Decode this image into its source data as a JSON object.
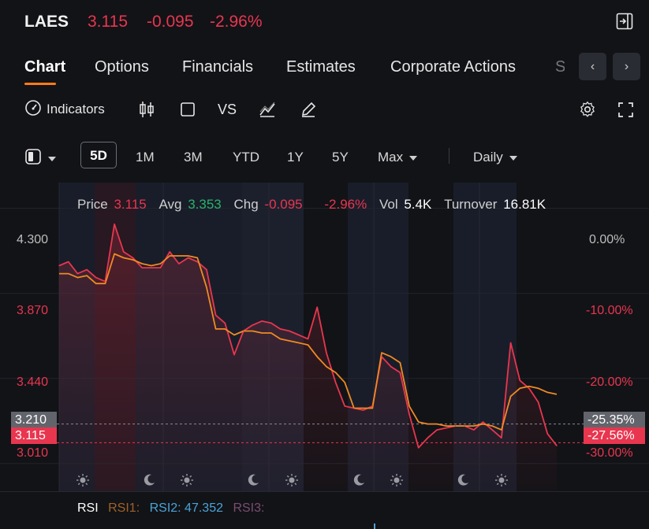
{
  "header": {
    "ticker": "LAES",
    "price": "3.115",
    "change": "-0.095",
    "change_pct": "-2.96%"
  },
  "tabs": [
    {
      "label": "Chart",
      "active": true
    },
    {
      "label": "Options"
    },
    {
      "label": "Financials"
    },
    {
      "label": "Estimates"
    },
    {
      "label": "Corporate Actions"
    },
    {
      "label": "S"
    }
  ],
  "toolbar": {
    "indicators_label": "Indicators",
    "vs_label": "VS"
  },
  "ranges": {
    "items": [
      "5D",
      "1M",
      "3M",
      "YTD",
      "1Y",
      "5Y",
      "Max"
    ],
    "selected": "5D",
    "interval": "Daily"
  },
  "info": {
    "price_label": "Price",
    "price": "3.115",
    "avg_label": "Avg",
    "avg": "3.353",
    "chg_label": "Chg",
    "chg": "-0.095",
    "chg_pct": "-2.96%",
    "vol_label": "Vol",
    "vol": "5.4K",
    "turnover_label": "Turnover",
    "turnover": "16.81K"
  },
  "rsi": {
    "label": "RSI",
    "rsi1": "RSI1:",
    "rsi2": "RSI2: 47.352",
    "rsi3": "RSI3:"
  },
  "colors": {
    "price_line": "#e8364f",
    "avg_line": "#f08a24",
    "down": "#e8364f",
    "up": "#27b36b",
    "accent": "#ff7a1a"
  },
  "chart_data": {
    "type": "line",
    "y_left_ticks": [
      "4.300",
      "3.870",
      "3.440",
      "3.010"
    ],
    "y_right_ticks": [
      "0.00%",
      "-10.00%",
      "-20.00%",
      "-30.00%"
    ],
    "ylim": [
      2.87,
      4.43
    ],
    "previous_close_label": "3.210",
    "previous_close_pct": "-25.35%",
    "last_price_label": "3.115",
    "last_price_pct": "-27.56%",
    "session_icons": [
      "sun",
      "moon",
      "sun",
      "moon",
      "sun",
      "moon",
      "sun",
      "moon",
      "sun"
    ],
    "series": [
      {
        "name": "Price",
        "values": [
          4.01,
          4.03,
          3.97,
          3.99,
          3.95,
          3.93,
          4.22,
          4.08,
          4.05,
          4.0,
          4.0,
          4.0,
          4.08,
          4.02,
          4.05,
          4.03,
          3.99,
          3.76,
          3.72,
          3.56,
          3.68,
          3.71,
          3.73,
          3.72,
          3.69,
          3.68,
          3.66,
          3.64,
          3.8,
          3.57,
          3.42,
          3.3,
          3.29,
          3.28,
          3.3,
          3.55,
          3.5,
          3.47,
          3.26,
          3.09,
          3.14,
          3.18,
          3.19,
          3.2,
          3.2,
          3.18,
          3.22,
          3.18,
          3.14,
          3.62,
          3.43,
          3.39,
          3.32,
          3.16,
          3.1
        ]
      },
      {
        "name": "Avg",
        "values": [
          3.97,
          3.97,
          3.95,
          3.96,
          3.92,
          3.92,
          4.07,
          4.05,
          4.04,
          4.02,
          4.01,
          4.02,
          4.06,
          4.06,
          4.06,
          4.05,
          3.9,
          3.69,
          3.69,
          3.66,
          3.68,
          3.68,
          3.67,
          3.67,
          3.64,
          3.63,
          3.62,
          3.61,
          3.55,
          3.5,
          3.47,
          3.42,
          3.29,
          3.29,
          3.29,
          3.57,
          3.55,
          3.52,
          3.3,
          3.22,
          3.21,
          3.21,
          3.2,
          3.2,
          3.2,
          3.2,
          3.21,
          3.2,
          3.18,
          3.35,
          3.39,
          3.4,
          3.39,
          3.37,
          3.36
        ]
      }
    ]
  }
}
